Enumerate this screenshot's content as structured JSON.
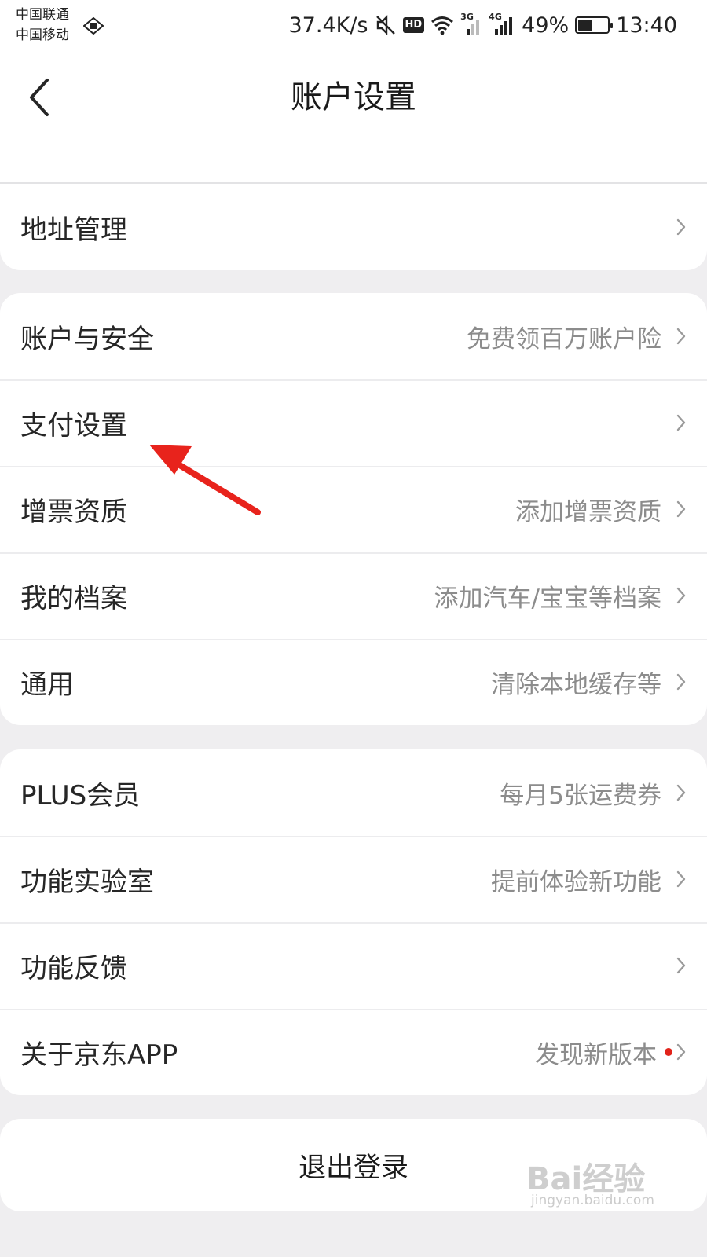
{
  "status_bar": {
    "carrier_1": "中国联通",
    "carrier_2": "中国移动",
    "net_speed": "37.4K/s",
    "hd": "HD",
    "sig1": "3G",
    "sig2": "4G",
    "battery": "49%",
    "battery_level": 0.49,
    "time": "13:40"
  },
  "header": {
    "title": "账户设置"
  },
  "groups": [
    {
      "items": [
        {
          "label": "地址管理",
          "value": ""
        }
      ]
    },
    {
      "items": [
        {
          "label": "账户与安全",
          "value": "免费领百万账户险"
        },
        {
          "label": "支付设置",
          "value": ""
        },
        {
          "label": "增票资质",
          "value": "添加增票资质"
        },
        {
          "label": "我的档案",
          "value": "添加汽车/宝宝等档案"
        },
        {
          "label": "通用",
          "value": "清除本地缓存等"
        }
      ]
    },
    {
      "items": [
        {
          "label": "PLUS会员",
          "value": "每月5张运费券"
        },
        {
          "label": "功能实验室",
          "value": "提前体验新功能"
        },
        {
          "label": "功能反馈",
          "value": ""
        },
        {
          "label": "关于京东APP",
          "value": "发现新版本",
          "badge": "red-dot"
        }
      ]
    }
  ],
  "logout": {
    "label": "退出登录"
  },
  "watermark": {
    "brand": "Bai经验",
    "url": "jingyan.baidu.com"
  },
  "colors": {
    "accent_red": "#e2231a",
    "annotation_red": "#e8231c",
    "background": "#efeef0"
  }
}
